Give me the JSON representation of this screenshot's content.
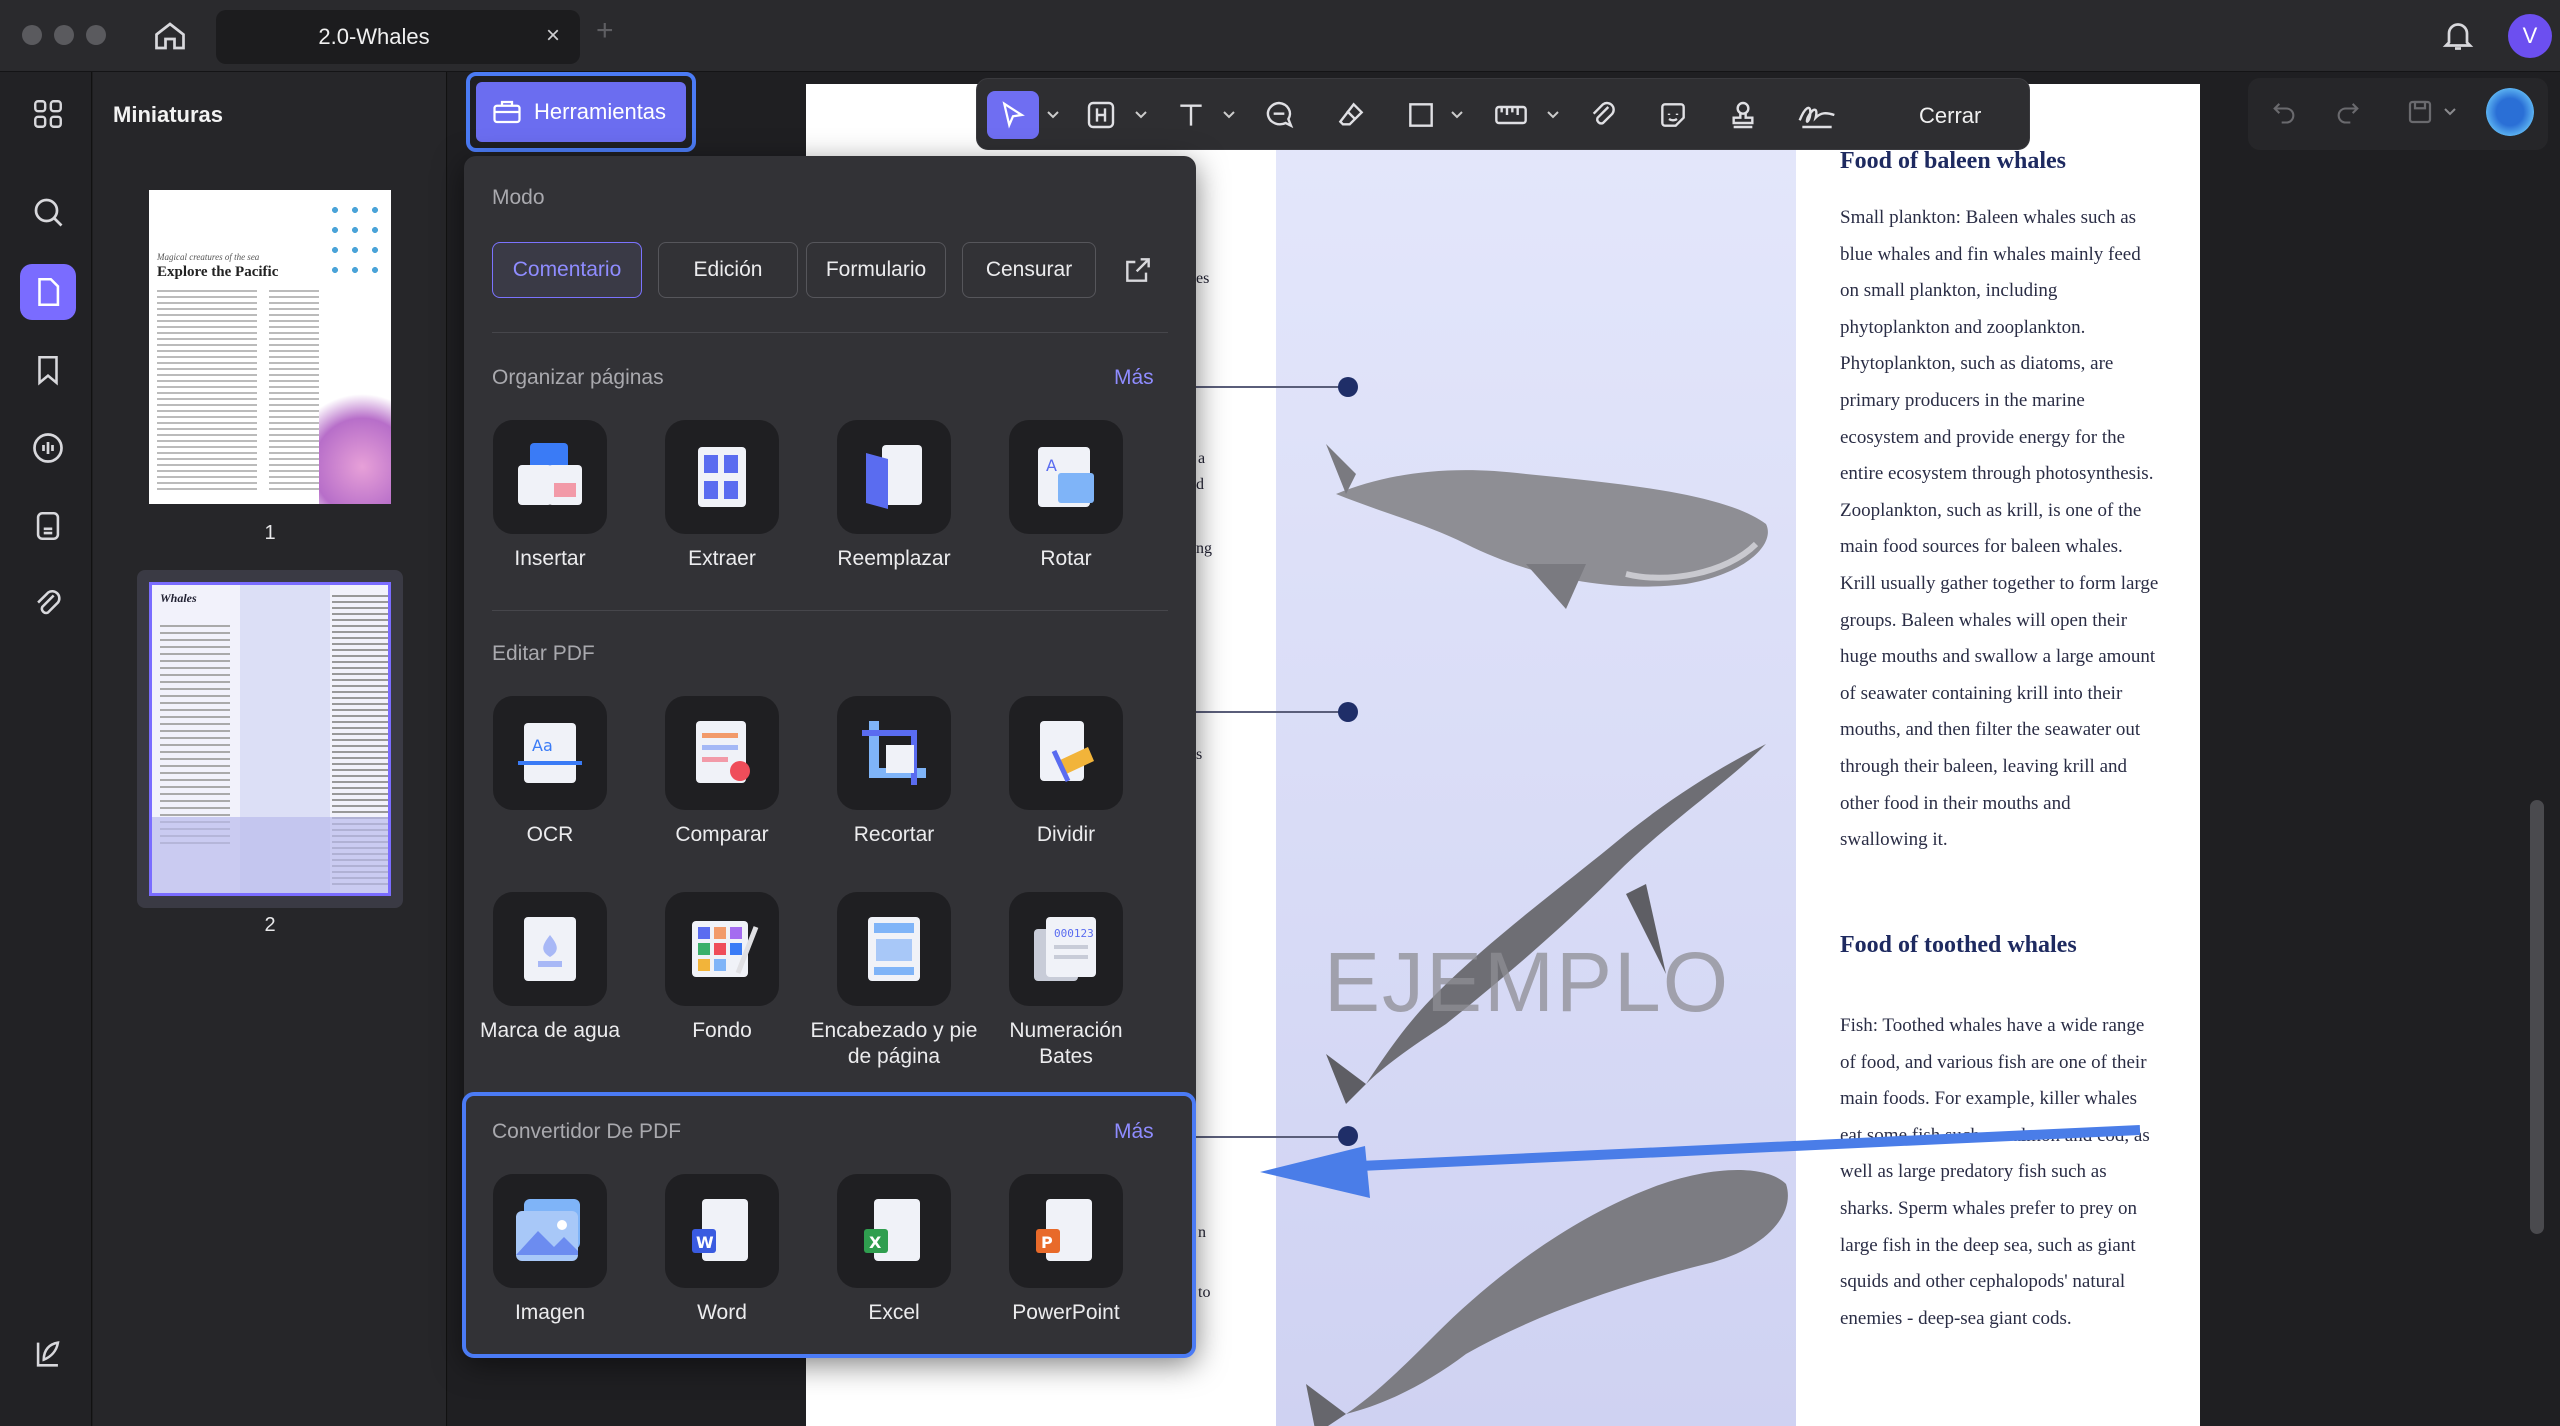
{
  "window": {
    "tab_title": "2.0-Whales",
    "tab_close": "×",
    "add_tab": "+",
    "avatar_letter": "V"
  },
  "thumbnails": {
    "title": "Miniaturas",
    "pages": [
      "1",
      "2"
    ],
    "page1_caption": "Magical creatures of the sea",
    "page1_title": "Explore the Pacific",
    "page2_title": "Whales"
  },
  "toolbar": {
    "herramientas_label": "Herramientas",
    "close_label": "Cerrar"
  },
  "document": {
    "watermark": "EJEMPLO",
    "heading_baleen": "Food of baleen whales",
    "baleen_text": "Small plankton: Baleen whales such as blue whales and fin whales mainly feed on small plankton, including phytoplankton and zooplankton. Phytoplankton, such as diatoms, are primary producers in the marine ecosystem and provide energy for the entire ecosystem through photosynthesis. Zooplankton, such as krill, is one of the main food sources for baleen whales. Krill usually gather together to form large groups. Baleen whales will open their huge mouths and swallow a large amount of seawater containing krill into their mouths, and then filter the seawater out through their baleen, leaving krill and other food in their mouths and swallowing it.",
    "heading_toothed": "Food of toothed whales",
    "toothed_text": "Fish: Toothed whales have a wide range of food, and various fish are one of their main foods. For example, killer whales eat some fish such as salmon and cod, as well as large predatory fish such as sharks. Sperm whales prefer to prey on large fish in the deep sea, such as giant squids and other cephalopods' natural enemies - deep-sea giant cods.",
    "partial_left": [
      "es",
      "a",
      "d",
      "ng",
      "s",
      "n",
      "to"
    ]
  },
  "panel": {
    "mode_label": "Modo",
    "modes": [
      "Comentario",
      "Edición",
      "Formulario",
      "Censurar"
    ],
    "organize": {
      "title": "Organizar páginas",
      "more": "Más",
      "tools": [
        "Insertar",
        "Extraer",
        "Reemplazar",
        "Rotar"
      ]
    },
    "edit": {
      "title": "Editar PDF",
      "tools_row1": [
        "OCR",
        "Comparar",
        "Recortar",
        "Dividir"
      ],
      "tools_row2": [
        "Marca de agua",
        "Fondo",
        "Encabezado y pie de página",
        "Numeración Bates"
      ]
    },
    "converter": {
      "title": "Convertidor De PDF",
      "more": "Más",
      "tools": [
        "Imagen",
        "Word",
        "Excel",
        "PowerPoint"
      ]
    }
  },
  "colors": {
    "accent": "#6b6df0",
    "highlight_border": "#4b7bf5",
    "arrow": "#4a7de8"
  }
}
